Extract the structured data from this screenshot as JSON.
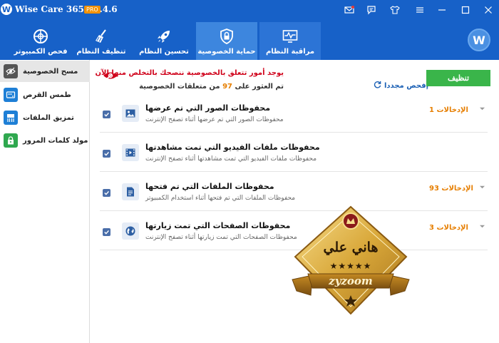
{
  "window": {
    "title": "Wise Care 365 - 5.4.6",
    "badge": "PRO",
    "controls": [
      "mail-icon",
      "feedback-icon",
      "skin-icon",
      "menu-icon",
      "minimize-icon",
      "maximize-icon",
      "close-icon"
    ]
  },
  "nav": {
    "tabs": [
      {
        "label": "فحص الكمبيوتر",
        "icon": "pc-checkup-icon"
      },
      {
        "label": "تنظيف النظام",
        "icon": "broom-icon"
      },
      {
        "label": "تحسين النظام",
        "icon": "rocket-icon"
      },
      {
        "label": "حماية الخصوصية",
        "icon": "lock-shield-icon",
        "selected": true
      },
      {
        "label": "مراقبة النظام",
        "icon": "monitor-pulse-icon"
      }
    ],
    "avatar_letter": "W"
  },
  "sidebar": {
    "items": [
      {
        "label": "مسح الخصوصية",
        "icon": "eye-icon",
        "selected": true
      },
      {
        "label": "طمس القرص",
        "icon": "disk-eraser-icon"
      },
      {
        "label": "تمزيق الملفات",
        "icon": "shredder-icon"
      },
      {
        "label": "مولد كلمات المرور",
        "icon": "password-lock-icon"
      }
    ]
  },
  "summary": {
    "headline": "يوجد أمور تتعلق بالخصوصية ننصحك بالتخلص منها الآن",
    "count_prefix": "تم العثور على",
    "count_value": "97",
    "count_suffix": "من متعلقات الخصوصية",
    "rescan_label": "إفحص مجددا",
    "clean_label": "تنظيف"
  },
  "rows": [
    {
      "title": "محفوظات الصور التي تم عرضها",
      "desc": "محفوظات الصور التي تم عرضها أثناء تصفح الإنترنت",
      "count": "الإدخالات 1",
      "checked": true,
      "icon": "image-icon"
    },
    {
      "title": "محفوظات ملفات الفيديو التي تمت مشاهدتها",
      "desc": "محفوظات ملفات الفيديو التي تمت مشاهدتها أثناء تصفح الإنترنت",
      "count": "",
      "checked": true,
      "icon": "video-icon"
    },
    {
      "title": "محفوظات الملفات التي تم فتحها",
      "desc": "محفوظات الملفات التي تم فتحها أثناء استخدام الكمبيوتر",
      "count": "الإدخالات 93",
      "checked": true,
      "icon": "document-icon"
    },
    {
      "title": "محفوظات الصفحات التي تمت زيارتها",
      "desc": "محفوظات الصفحات التي تمت زيارتها أثناء تصفح الإنترنت",
      "count": "الإدخالات 3",
      "checked": true,
      "icon": "globe-icon"
    }
  ],
  "watermark": {
    "name": "هاني علي",
    "stars": "★★★★★",
    "brand": "zyzoom"
  },
  "colors": {
    "titlebar": "#1761c8",
    "selected_tab": "#3d86de",
    "clean_button": "#3ab54a",
    "warning_text": "#d0021b",
    "count_orange": "#e67e00",
    "checkbox": "#4a6ea9",
    "seal_gold": "#d9a83a"
  }
}
